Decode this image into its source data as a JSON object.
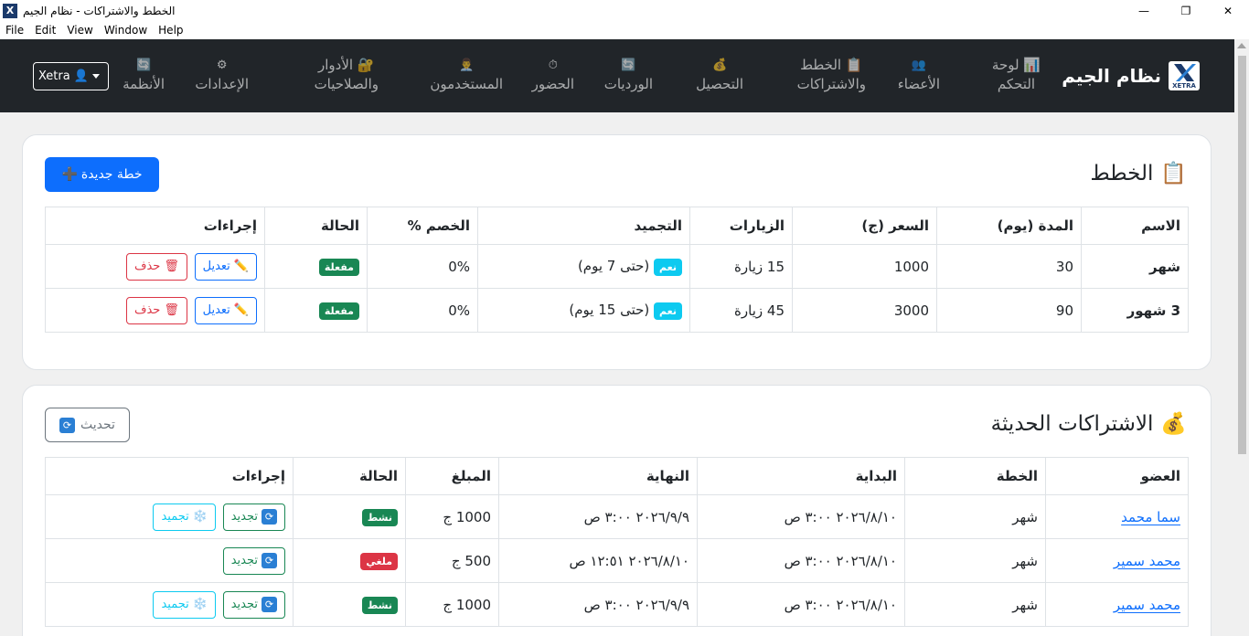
{
  "window": {
    "title": "الخطط والاشتراكات - نظام الجيم",
    "app_icon_label": "X",
    "minimize": "—",
    "maximize": "❐",
    "close": "✕"
  },
  "menu": [
    "File",
    "Edit",
    "View",
    "Window",
    "Help"
  ],
  "navbar": {
    "brand": "نظام الجيم",
    "logo_text": "XETRA",
    "items": [
      {
        "line1": "📊 لوحة",
        "line2": "التحكم"
      },
      {
        "line1": "👥",
        "line2": "الأعضاء"
      },
      {
        "line1": "📋 الخطط",
        "line2": "والاشتراكات"
      },
      {
        "line1": "💰",
        "line2": "التحصيل"
      },
      {
        "line1": "🔄",
        "line2": "الورديات"
      },
      {
        "line1": "⏱",
        "line2": "الحضور"
      },
      {
        "line1": "👨‍💼",
        "line2": "المستخدمون"
      },
      {
        "line1": "🔐 الأدوار",
        "line2": "والصلاحيات"
      },
      {
        "line1": "⚙",
        "line2": "الإعدادات"
      },
      {
        "line1": "🔄",
        "line2": "الأنظمة"
      }
    ],
    "user_button": "Xetra 👤"
  },
  "plans": {
    "title": "الخطط",
    "title_icon": "📋",
    "new_button": "خطة جديدة",
    "new_button_icon": "➕",
    "headers": [
      "الاسم",
      "المدة (يوم)",
      "السعر (ج)",
      "الزيارات",
      "التجميد",
      "الخصم %",
      "الحالة",
      "إجراءات"
    ],
    "rows": [
      {
        "name": "شهر",
        "duration": "30",
        "price": "1000",
        "visits": "15 زيارة",
        "freeze_badge": "نعم",
        "freeze_text": "(حتى 7 يوم)",
        "discount": "0%",
        "status": "مفعلة"
      },
      {
        "name": "3 شهور",
        "duration": "90",
        "price": "3000",
        "visits": "45 زيارة",
        "freeze_badge": "نعم",
        "freeze_text": "(حتى 15 يوم)",
        "discount": "0%",
        "status": "مفعلة"
      }
    ],
    "edit_label": "تعديل",
    "edit_icon": "✏️",
    "delete_label": "حذف",
    "delete_icon": "🗑"
  },
  "subscriptions": {
    "title": "الاشتراكات الحديثة",
    "title_icon": "💰",
    "refresh_button": "تحديث",
    "refresh_icon": "🔄",
    "headers": [
      "العضو",
      "الخطة",
      "البداية",
      "النهاية",
      "المبلغ",
      "الحالة",
      "إجراءات"
    ],
    "rows": [
      {
        "member": "سما محمد",
        "plan": "شهر",
        "start": "٢٠٢٦/٨/١٠ ٣:٠٠ ص",
        "end": "٢٠٢٦/٩/٩ ٣:٠٠ ص",
        "amount": "1000 ج",
        "status": "نشط",
        "status_type": "success",
        "freeze": true
      },
      {
        "member": "محمد سمير",
        "plan": "شهر",
        "start": "٢٠٢٦/٨/١٠ ٣:٠٠ ص",
        "end": "٢٠٢٦/٨/١٠ ١٢:٥١ ص",
        "amount": "500 ج",
        "status": "ملغي",
        "status_type": "danger",
        "freeze": false
      },
      {
        "member": "محمد سمير",
        "plan": "شهر",
        "start": "٢٠٢٦/٨/١٠ ٣:٠٠ ص",
        "end": "٢٠٢٦/٩/٩ ٣:٠٠ ص",
        "amount": "1000 ج",
        "status": "نشط",
        "status_type": "success",
        "freeze": true
      }
    ],
    "renew_label": "تجديد",
    "renew_icon": "🔄",
    "freeze_label": "تجميد",
    "freeze_icon": "❄️"
  },
  "colors": {
    "navbar_bg": "#212529",
    "primary": "#0d6efd",
    "success": "#198754",
    "danger": "#dc3545",
    "info": "#0dcaf0"
  }
}
